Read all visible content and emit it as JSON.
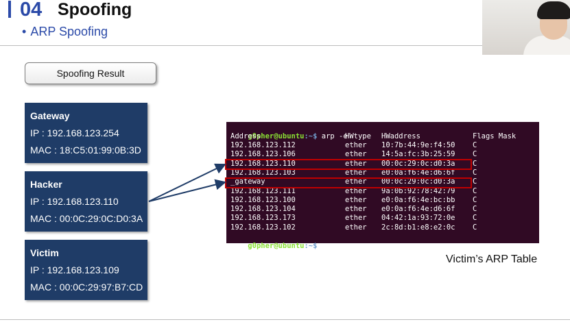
{
  "header": {
    "section_number": "04",
    "title": "Spoofing",
    "bullet": "•",
    "subtitle": "ARP Spoofing"
  },
  "result_button": {
    "label": "Spoofing Result"
  },
  "cards": [
    {
      "title": "Gateway",
      "ip": "IP : 192.168.123.254",
      "mac": "MAC : 18:C5:01:99:0B:3D"
    },
    {
      "title": "Hacker",
      "ip": "IP : 192.168.123.110",
      "mac": "MAC : 00:0C:29:0C:D0:3A"
    },
    {
      "title": "Victim",
      "ip": "IP : 192.168.123.109",
      "mac": "MAC : 00:0C:29:97:B7:CD"
    }
  ],
  "terminal": {
    "prompt_user": "g0pher@ubuntu",
    "prompt_sep": ":~$",
    "command": " arp -e",
    "headers": {
      "address": "Address",
      "hwtype": "HWtype",
      "hwaddress": "HWaddress",
      "flags": "Flags Mask"
    },
    "rows": [
      {
        "address": "192.168.123.112",
        "hwtype": "ether",
        "hwaddress": "10:7b:44:9e:f4:50",
        "flags": "C"
      },
      {
        "address": "192.168.123.106",
        "hwtype": "ether",
        "hwaddress": "14:5a:fc:3b:25:59",
        "flags": "C"
      },
      {
        "address": "192.168.123.110",
        "hwtype": "ether",
        "hwaddress": "00:0c:29:0c:d0:3a",
        "flags": "C"
      },
      {
        "address": "192.168.123.103",
        "hwtype": "ether",
        "hwaddress": "e0:0a:f6:4e:d6:6f",
        "flags": "C"
      },
      {
        "address": "_gateway",
        "hwtype": "ether",
        "hwaddress": "00:0c:29:0c:d0:3a",
        "flags": "C"
      },
      {
        "address": "192.168.123.111",
        "hwtype": "ether",
        "hwaddress": "9a:0b:92:78:42:79",
        "flags": "C"
      },
      {
        "address": "192.168.123.100",
        "hwtype": "ether",
        "hwaddress": "e0:0a:f6:4e:bc:bb",
        "flags": "C"
      },
      {
        "address": "192.168.123.104",
        "hwtype": "ether",
        "hwaddress": "e0:0a:f6:4e:d6:6f",
        "flags": "C"
      },
      {
        "address": "192.168.123.173",
        "hwtype": "ether",
        "hwaddress": "04:42:1a:93:72:0e",
        "flags": "C"
      },
      {
        "address": "192.168.123.102",
        "hwtype": "ether",
        "hwaddress": "2c:8d:b1:e8:e2:0c",
        "flags": "C"
      }
    ],
    "final_prompt_user": "g0pher@ubuntu",
    "final_prompt_sep": ":~$"
  },
  "caption": "Victim’s ARP Table",
  "colors": {
    "accent": "#2b4aa8",
    "card_bg": "#1f3c67",
    "terminal_bg": "#300a24",
    "highlight": "#c00000",
    "prompt_user": "#8ae234",
    "prompt_path": "#729fcf"
  }
}
